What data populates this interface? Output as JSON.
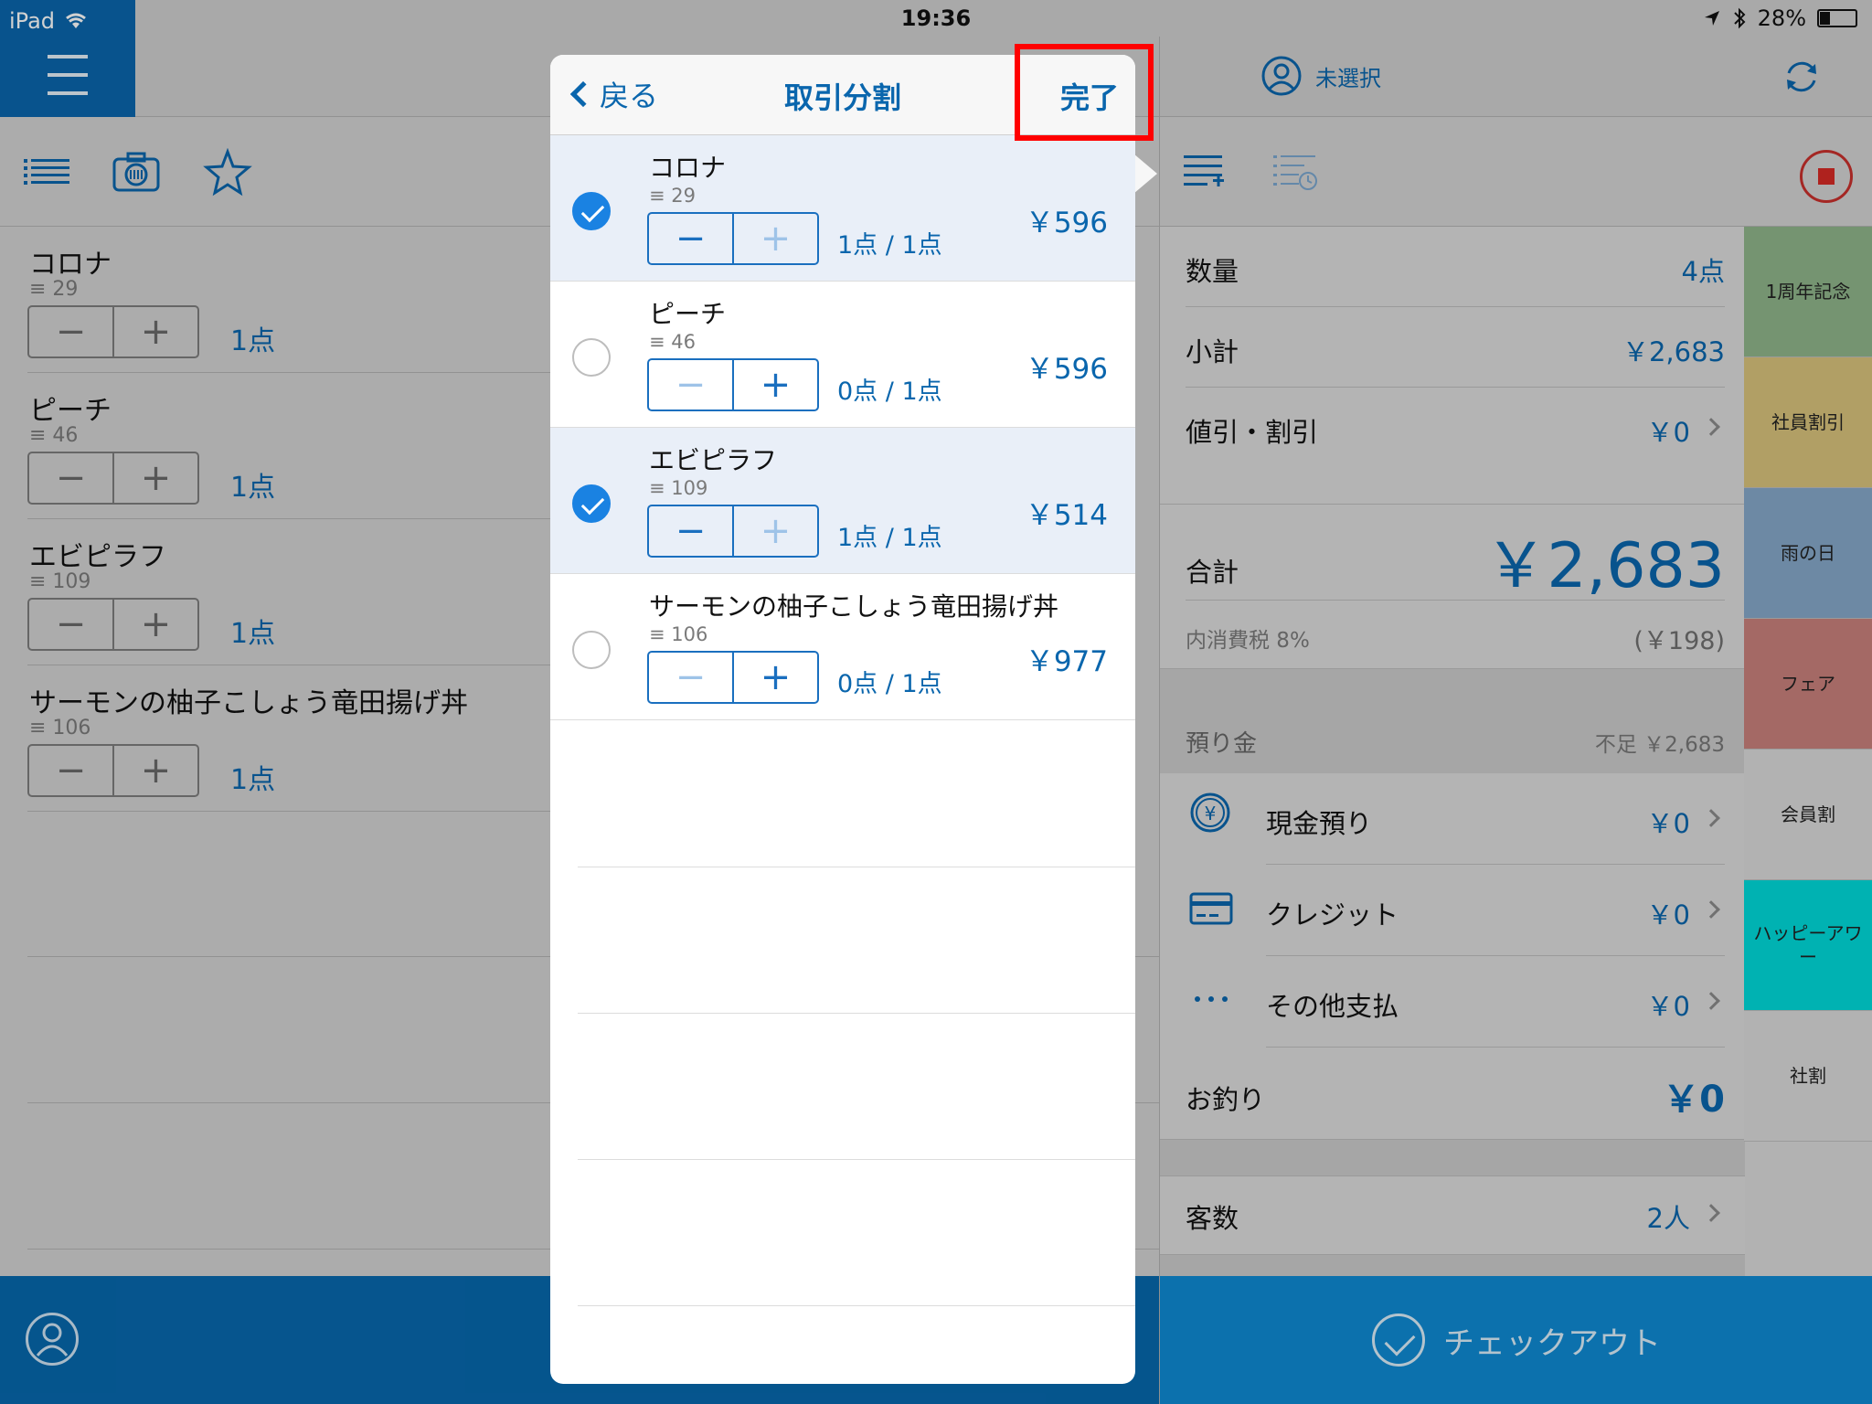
{
  "status_bar": {
    "device": "iPad",
    "time": "19:36",
    "battery": "28%",
    "battery_level": 0.28
  },
  "left": {
    "items": [
      {
        "name": "コロナ",
        "stock": "≡ 29",
        "qty": "1点"
      },
      {
        "name": "ピーチ",
        "stock": "≡ 46",
        "qty": "1点"
      },
      {
        "name": "エビピラフ",
        "stock": "≡ 109",
        "qty": "1点"
      },
      {
        "name": "サーモンの柚子こしょう竜田揚げ丼",
        "stock": "≡ 106",
        "qty": "1点"
      }
    ],
    "minus": "−",
    "plus": "+"
  },
  "popover": {
    "back_label": "戻る",
    "title": "取引分割",
    "done_label": "完了",
    "items": [
      {
        "name": "コロナ",
        "stock": "≡ 29",
        "count": "1点 / 1点",
        "price": "￥596",
        "selected": true
      },
      {
        "name": "ピーチ",
        "stock": "≡ 46",
        "count": "0点 / 1点",
        "price": "￥596",
        "selected": false
      },
      {
        "name": "エビピラフ",
        "stock": "≡ 109",
        "count": "1点 / 1点",
        "price": "￥514",
        "selected": true
      },
      {
        "name": "サーモンの柚子こしょう竜田揚げ丼",
        "stock": "≡ 106",
        "count": "0点 / 1点",
        "price": "￥977",
        "selected": false
      }
    ]
  },
  "right": {
    "user_status": "未選択",
    "quantity": {
      "label": "数量",
      "value": "4点"
    },
    "subtotal": {
      "label": "小計",
      "value": "￥2,683"
    },
    "discount": {
      "label": "値引・割引",
      "value": "￥0"
    },
    "total": {
      "label": "合計",
      "value": "￥2,683"
    },
    "tax": {
      "label": "内消費税 8%",
      "value": "(￥198)"
    },
    "deposit": {
      "label": "預り金",
      "value": "不足 ￥2,683"
    },
    "cash": {
      "label": "現金預り",
      "value": "￥0"
    },
    "credit": {
      "label": "クレジット",
      "value": "￥0"
    },
    "other": {
      "label": "その他支払",
      "value": "￥0"
    },
    "change": {
      "label": "お釣り",
      "value": "￥0"
    },
    "guests": {
      "label": "客数",
      "value": "2人"
    },
    "checkout_label": "チェックアウト"
  },
  "categories": [
    {
      "label": "1周年記念",
      "color": "#8fb58a"
    },
    {
      "label": "社員割引",
      "color": "#d8c27c"
    },
    {
      "label": "雨の日",
      "color": "#86a8c8"
    },
    {
      "label": "フェア",
      "color": "#c9807c"
    },
    {
      "label": "会員割",
      "color": "#d9d9d9"
    },
    {
      "label": "ハッピーアワー",
      "color": "#00d9d9"
    },
    {
      "label": "社割",
      "color": "#d9d9d9"
    }
  ],
  "colors": {
    "brand": "#0a66ad",
    "checkout": "#0f8ad3",
    "highlight": "#ff0000"
  }
}
